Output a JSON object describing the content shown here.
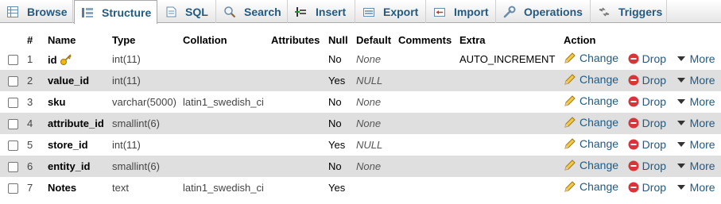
{
  "tabs": [
    {
      "label": "Browse",
      "icon": "browse-icon"
    },
    {
      "label": "Structure",
      "icon": "structure-icon",
      "active": true
    },
    {
      "label": "SQL",
      "icon": "sql-icon"
    },
    {
      "label": "Search",
      "icon": "search-icon"
    },
    {
      "label": "Insert",
      "icon": "insert-icon"
    },
    {
      "label": "Export",
      "icon": "export-icon"
    },
    {
      "label": "Import",
      "icon": "import-icon"
    },
    {
      "label": "Operations",
      "icon": "wrench-icon"
    },
    {
      "label": "Triggers",
      "icon": "triggers-icon"
    }
  ],
  "columns": {
    "num": "#",
    "name": "Name",
    "type": "Type",
    "collation": "Collation",
    "attributes": "Attributes",
    "null": "Null",
    "default": "Default",
    "comments": "Comments",
    "extra": "Extra",
    "action": "Action"
  },
  "actions": {
    "change": "Change",
    "drop": "Drop",
    "more": "More"
  },
  "rows": [
    {
      "num": "1",
      "name": "id",
      "type": "int(11)",
      "collation": "",
      "attributes": "",
      "null": "No",
      "default": "None",
      "comments": "",
      "extra": "AUTO_INCREMENT"
    },
    {
      "num": "2",
      "name": "value_id",
      "type": "int(11)",
      "collation": "",
      "attributes": "",
      "null": "Yes",
      "default": "NULL",
      "comments": "",
      "extra": ""
    },
    {
      "num": "3",
      "name": "sku",
      "type": "varchar(5000)",
      "collation": "latin1_swedish_ci",
      "attributes": "",
      "null": "No",
      "default": "None",
      "comments": "",
      "extra": ""
    },
    {
      "num": "4",
      "name": "attribute_id",
      "type": "smallint(6)",
      "collation": "",
      "attributes": "",
      "null": "No",
      "default": "None",
      "comments": "",
      "extra": ""
    },
    {
      "num": "5",
      "name": "store_id",
      "type": "int(11)",
      "collation": "",
      "attributes": "",
      "null": "Yes",
      "default": "NULL",
      "comments": "",
      "extra": ""
    },
    {
      "num": "6",
      "name": "entity_id",
      "type": "smallint(6)",
      "collation": "",
      "attributes": "",
      "null": "No",
      "default": "None",
      "comments": "",
      "extra": ""
    },
    {
      "num": "7",
      "name": "Notes",
      "type": "text",
      "collation": "latin1_swedish_ci",
      "attributes": "",
      "null": "Yes",
      "default": "",
      "comments": "",
      "extra": ""
    }
  ],
  "colors": {
    "link": "#235a81",
    "row_alt": "#dfdfdf",
    "drop_red": "#d9343a",
    "key_gold": "#e0a800"
  }
}
